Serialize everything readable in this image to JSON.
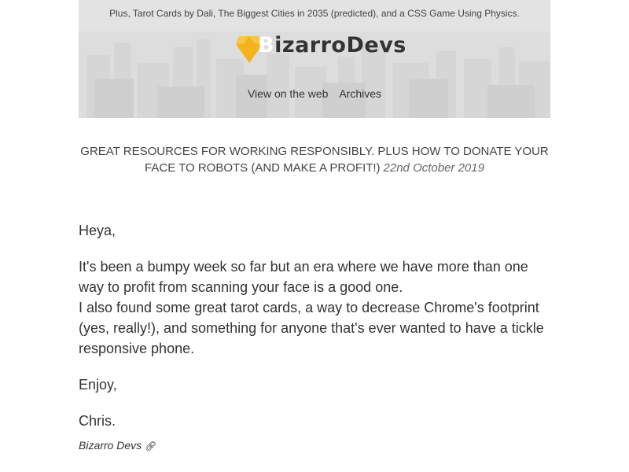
{
  "header": {
    "preheader": "Plus, Tarot Cards by Dali, The Biggest Cities in 2035 (predicted), and a CSS Game Using Physics.",
    "logo": {
      "letter": "B",
      "rest": "izarroDevs",
      "gem_color": "#f5b21b"
    },
    "nav": {
      "view_web": "View on the web",
      "archives": "Archives"
    }
  },
  "subject": {
    "line1": "Great resources for working responsibly. Plus how to donate your",
    "line2": "face to robots (and make a profit!)",
    "date": "22nd October 2019"
  },
  "body": {
    "greeting": "Heya,",
    "para1": "It's been a bumpy week so far but an era where we have more than one way to profit from scanning your face is a good one.",
    "para2": "I also found some great tarot cards, a way to decrease Chrome's footprint (yes, really!), and something for anyone that's ever wanted to have a tickle responsive phone.",
    "closing": "Enjoy,",
    "name": "Chris."
  },
  "signature": {
    "label": "Bizarro Devs",
    "icon": "link-icon"
  }
}
